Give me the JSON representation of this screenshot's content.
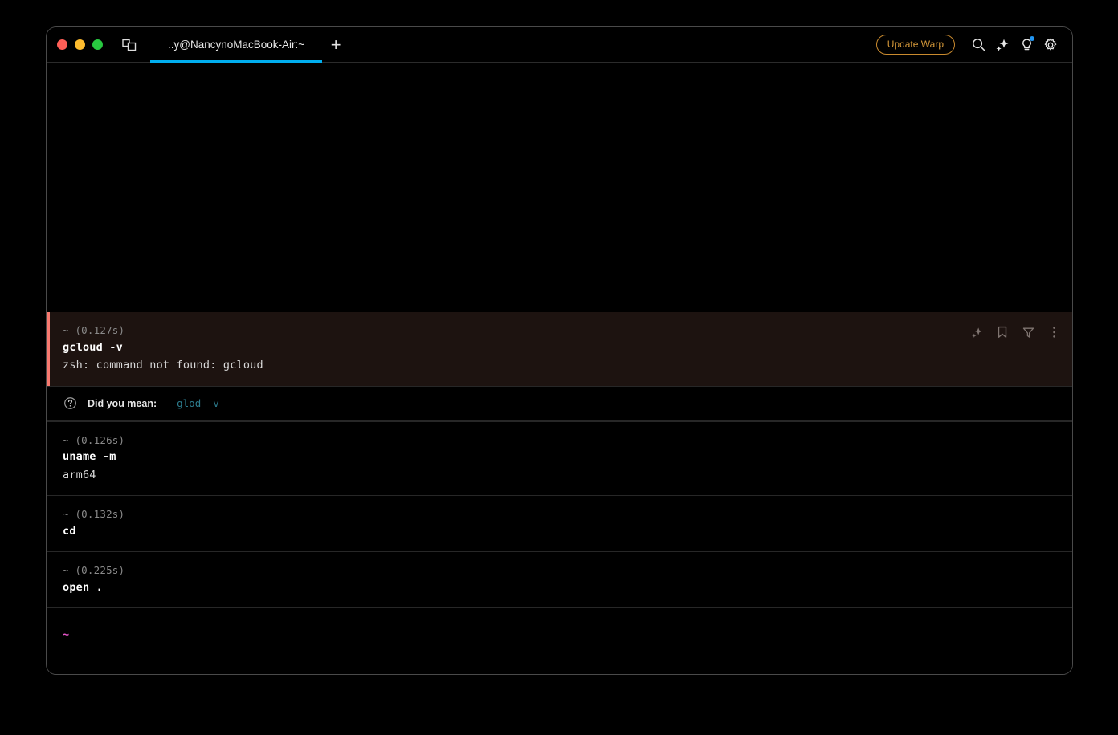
{
  "window": {
    "traffic_lights": [
      "close",
      "minimize",
      "maximize"
    ],
    "panes_icon": "split-panes-icon"
  },
  "tabs": [
    {
      "label": "..y@NancynoMacBook-Air:~",
      "active": true
    }
  ],
  "new_tab_label": "+",
  "toolbar": {
    "update_label": "Update Warp",
    "icons": [
      {
        "name": "search-icon"
      },
      {
        "name": "sparkle-ai-icon"
      },
      {
        "name": "lightbulb-icon",
        "badge": true
      },
      {
        "name": "gear-icon"
      }
    ]
  },
  "blocks": [
    {
      "meta": "~ (0.127s)",
      "command": "gcloud -v",
      "output": "zsh: command not found: gcloud",
      "error": true,
      "actions": [
        "sparkle-ai-icon",
        "bookmark-icon",
        "filter-icon",
        "kebab-menu-icon"
      ]
    },
    {
      "meta": "~ (0.126s)",
      "command": "uname -m",
      "output": "arm64",
      "error": false
    },
    {
      "meta": "~ (0.132s)",
      "command": "cd",
      "output": "",
      "error": false
    },
    {
      "meta": "~ (0.225s)",
      "command": "open .",
      "output": "",
      "error": false
    }
  ],
  "suggestion": {
    "icon": "question-circle-icon",
    "label": "Did you mean:",
    "command": "glod -v"
  },
  "prompt": {
    "symbol": "~",
    "input": ""
  },
  "colors": {
    "accent_tab": "#00AEEF",
    "error_border": "#f8796f",
    "error_bg": "#1d1310",
    "update_btn": "#c98a2e",
    "suggestion_text": "#2d7d8f",
    "prompt_symbol": "#e555c8",
    "badge": "#2196f3"
  }
}
